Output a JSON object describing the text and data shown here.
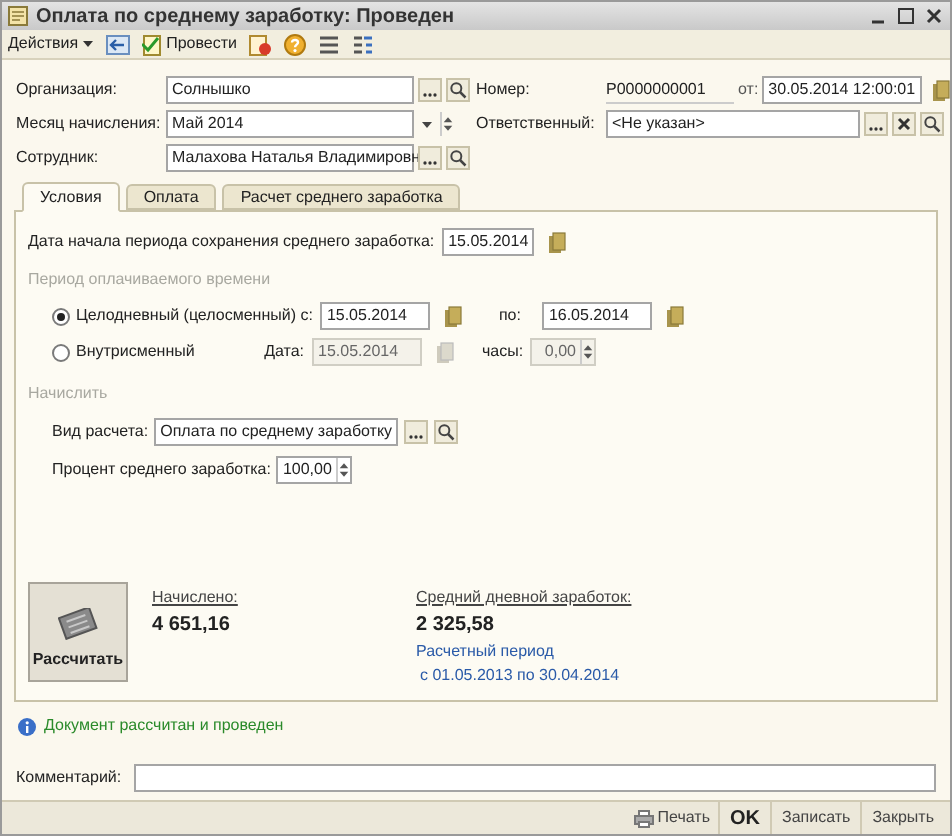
{
  "window": {
    "title": "Оплата по среднему заработку: Проведен"
  },
  "toolbar": {
    "actions_menu": "Действия",
    "post_button": "Провести"
  },
  "header": {
    "organization": {
      "label": "Организация:",
      "value": "Солнышко"
    },
    "month": {
      "label": "Месяц начисления:",
      "value": "Май 2014"
    },
    "employee": {
      "label": "Сотрудник:",
      "value": "Малахова Наталья Владимировн"
    },
    "number": {
      "label": "Номер:",
      "value": "Р0000000001"
    },
    "date": {
      "label": "от:",
      "value": "30.05.2014 12:00:01"
    },
    "responsible": {
      "label": "Ответственный:",
      "value": "<Не указан>"
    }
  },
  "tabs": [
    {
      "label": "Условия",
      "selected": true
    },
    {
      "label": "Оплата",
      "selected": false
    },
    {
      "label": "Расчет среднего заработка",
      "selected": false
    }
  ],
  "conditions": {
    "start_date_label": "Дата начала периода сохранения среднего заработка:",
    "start_date": "15.05.2014",
    "period_group": "Период оплачиваемого времени",
    "options": [
      {
        "label": "Целодневный (целосменный) с:",
        "selected": true
      },
      {
        "label": "Внутрисменный",
        "selected": false
      }
    ],
    "from": "15.05.2014",
    "to_label": "по:",
    "to": "16.05.2014",
    "date_label": "Дата:",
    "date": "15.05.2014",
    "hours_label": "часы:",
    "hours": "0,00",
    "accrue_group": "Начислить",
    "calc_type_label": "Вид расчета:",
    "calc_type": "Оплата по среднему заработку",
    "percent_label": "Процент среднего заработка:",
    "percent": "100,00"
  },
  "calculate_button": "Рассчитать",
  "accrued": {
    "label": "Начислено:",
    "value": "4 651,16"
  },
  "average": {
    "label": "Средний дневной заработок:",
    "value": "2 325,58",
    "period_label": "Расчетный период",
    "period": "с 01.05.2013 по 30.04.2014"
  },
  "info": "Документ рассчитан и проведен",
  "comment": {
    "label": "Комментарий:"
  },
  "footer_buttons": [
    {
      "label": "Печать",
      "kind": "print"
    },
    {
      "label": "OK",
      "kind": "default"
    },
    {
      "label": "Записать",
      "kind": "plain"
    },
    {
      "label": "Закрыть",
      "kind": "plain"
    }
  ]
}
